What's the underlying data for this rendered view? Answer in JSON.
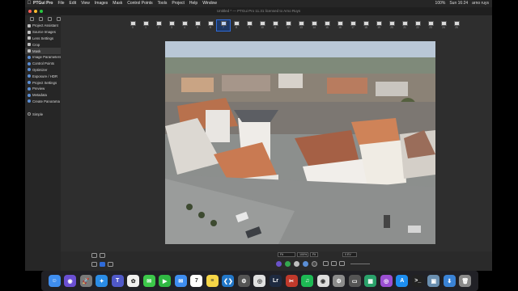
{
  "menubar": {
    "app": "PTGui Pro",
    "items": [
      "File",
      "Edit",
      "View",
      "Images",
      "Mask",
      "Control Points",
      "Tools",
      "Project",
      "Help",
      "Window"
    ],
    "status": [
      "100%",
      "Sun 16:24",
      "arno ruys"
    ]
  },
  "window": {
    "title": "Untitled * — PTGui Pro 11.31 licensed to Arno Ruys"
  },
  "sidebar": {
    "items": [
      {
        "label": "Project Assistant",
        "icon": "check-icon"
      },
      {
        "label": "Source Images",
        "icon": "check-icon"
      },
      {
        "label": "Lens Settings",
        "icon": "check-icon"
      },
      {
        "label": "Crop",
        "icon": "check-icon"
      },
      {
        "label": "Mask",
        "icon": "check-icon",
        "active": true
      },
      {
        "label": "Image Parameters",
        "icon": "dot-icon"
      },
      {
        "label": "Control Points",
        "icon": "dot-icon"
      },
      {
        "label": "Optimizer",
        "icon": "dot-icon"
      },
      {
        "label": "Exposure / HDR",
        "icon": "dot-icon"
      },
      {
        "label": "Project Settings",
        "icon": "dot-icon"
      },
      {
        "label": "Preview",
        "icon": "dot-icon"
      },
      {
        "label": "Metadata",
        "icon": "dot-icon"
      },
      {
        "label": "Create Panorama",
        "icon": "dot-icon"
      },
      {
        "label": "",
        "icon": ""
      },
      {
        "label": "Simple",
        "icon": "empty-circle-icon"
      }
    ]
  },
  "thumbnails": {
    "labels": [
      "0",
      "1",
      "2",
      "3",
      "4",
      "5",
      "6",
      "7",
      "8",
      "9",
      "10",
      "11",
      "12",
      "13",
      "14",
      "15",
      "16",
      "17",
      "18",
      "19",
      "20",
      "21",
      "22",
      "23",
      "24",
      "25"
    ],
    "selected_index": 7
  },
  "bottombar": {
    "zoom_mode": "Fit",
    "zoom_percent": "100%",
    "zoom_fit": "Fit",
    "exposure": "0 EV"
  },
  "dock": {
    "apps": [
      {
        "name": "finder-icon",
        "color": "#3f8ef0",
        "glyph": "☺"
      },
      {
        "name": "siri-icon",
        "color": "#6a4fd3",
        "glyph": "◉"
      },
      {
        "name": "launchpad-icon",
        "color": "#7a7a7a",
        "glyph": "🚀"
      },
      {
        "name": "safari-icon",
        "color": "#2a8ce6",
        "glyph": "✦"
      },
      {
        "name": "teams-icon",
        "color": "#5059c9",
        "glyph": "T"
      },
      {
        "name": "photos-icon",
        "color": "#f0f0f0",
        "glyph": "✿"
      },
      {
        "name": "messages-icon",
        "color": "#3cc84a",
        "glyph": "✉"
      },
      {
        "name": "facetime-icon",
        "color": "#2fb843",
        "glyph": "▶"
      },
      {
        "name": "mail-icon",
        "color": "#3e8df0",
        "glyph": "✉"
      },
      {
        "name": "calendar-icon",
        "color": "#ffffff",
        "glyph": "7"
      },
      {
        "name": "notes-icon",
        "color": "#f5d547",
        "glyph": "≡"
      },
      {
        "name": "vscode-icon",
        "color": "#2277c9",
        "glyph": "❮❯"
      },
      {
        "name": "ptgui-icon",
        "color": "#555555",
        "glyph": "⚙"
      },
      {
        "name": "chrome-icon",
        "color": "#e0e0e0",
        "glyph": "◎"
      },
      {
        "name": "lightroom-icon",
        "color": "#1e2a40",
        "glyph": "Lr"
      },
      {
        "name": "tools-icon",
        "color": "#c0392b",
        "glyph": "✂"
      },
      {
        "name": "spotify-icon",
        "color": "#1db954",
        "glyph": "♫"
      },
      {
        "name": "google-chrome-icon",
        "color": "#dddddd",
        "glyph": "◉"
      },
      {
        "name": "settings-icon",
        "color": "#8c8c8c",
        "glyph": "⚙"
      },
      {
        "name": "screen-icon",
        "color": "#555555",
        "glyph": "▭"
      },
      {
        "name": "grid-app-icon",
        "color": "#2aa26b",
        "glyph": "▦"
      },
      {
        "name": "podcast-icon",
        "color": "#9b4fd3",
        "glyph": "◎"
      },
      {
        "name": "app-store-icon",
        "color": "#1d8ef0",
        "glyph": "A"
      },
      {
        "name": "terminal-icon",
        "color": "#222222",
        "glyph": ">_"
      },
      {
        "name": "preview-icon",
        "color": "#6a8fb0",
        "glyph": "▣"
      },
      {
        "name": "downloads-icon",
        "color": "#3a83d6",
        "glyph": "⬇"
      },
      {
        "name": "trash-icon",
        "color": "#8a8a8a",
        "glyph": "🗑"
      }
    ]
  }
}
